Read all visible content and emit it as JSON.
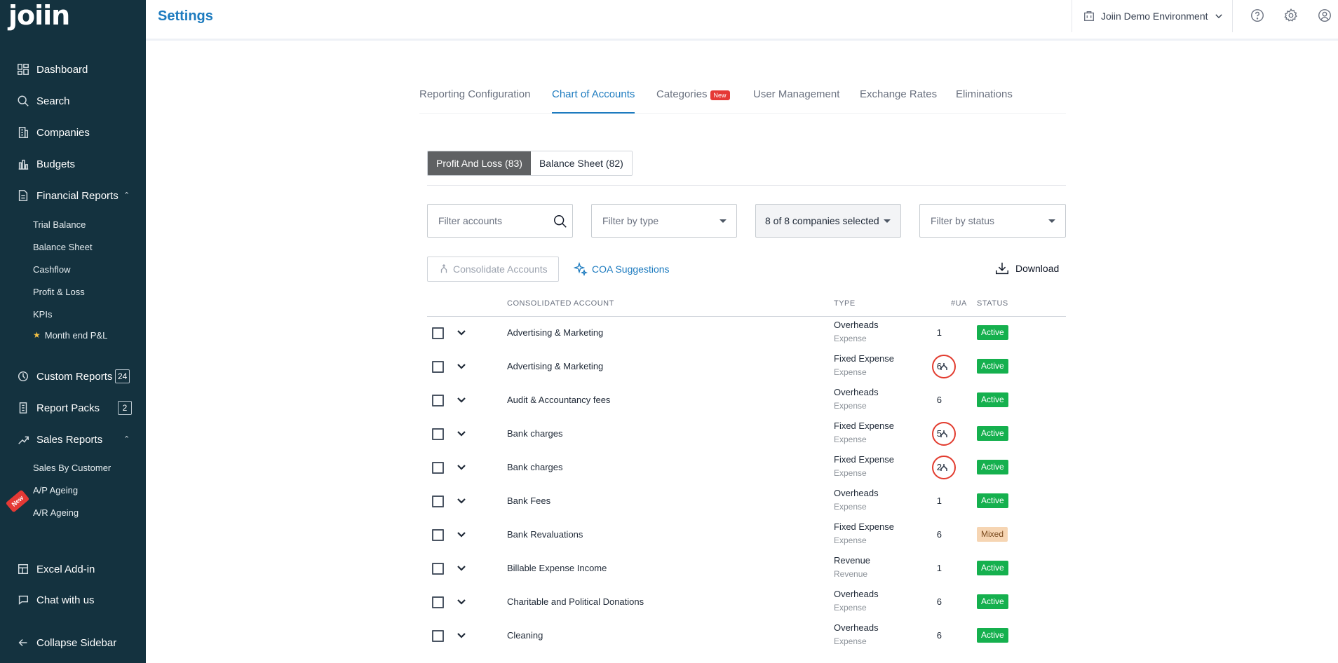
{
  "app": {
    "logo": "joiin"
  },
  "header": {
    "title": "Settings",
    "environment": "Joiin Demo Environment"
  },
  "sidebar": {
    "items": [
      {
        "label": "Dashboard",
        "icon": "dashboard-icon"
      },
      {
        "label": "Search",
        "icon": "search-icon"
      },
      {
        "label": "Companies",
        "icon": "building-icon"
      },
      {
        "label": "Budgets",
        "icon": "bar-chart-icon"
      },
      {
        "label": "Financial Reports",
        "icon": "file-report-icon"
      },
      {
        "label": "Custom Reports",
        "icon": "custom-report-icon",
        "badge": "24"
      },
      {
        "label": "Report Packs",
        "icon": "report-pack-icon",
        "badge": "2"
      },
      {
        "label": "Sales Reports",
        "icon": "sales-icon"
      },
      {
        "label": "Excel Add-in",
        "icon": "excel-icon"
      },
      {
        "label": "Chat with us",
        "icon": "chat-icon"
      },
      {
        "label": "Collapse Sidebar",
        "icon": "arrow-left-icon"
      }
    ],
    "financial_sub": [
      "Trial Balance",
      "Balance Sheet",
      "Cashflow",
      "Profit & Loss",
      "KPIs",
      "Month end P&L"
    ],
    "sales_sub": [
      "Sales By Customer",
      "A/P Ageing",
      "A/R Ageing"
    ],
    "new_ribbon": "New"
  },
  "tabs": [
    {
      "label": "Reporting Configuration"
    },
    {
      "label": "Chart of Accounts"
    },
    {
      "label": "Categories",
      "pill": "New"
    },
    {
      "label": "User Management"
    },
    {
      "label": "Exchange Rates"
    },
    {
      "label": "Eliminations"
    }
  ],
  "segment": {
    "pl": "Profit And Loss (83)",
    "bs": "Balance Sheet (82)"
  },
  "filters": {
    "accounts_placeholder": "Filter accounts",
    "type": "Filter by type",
    "companies": "8 of 8 companies selected",
    "status": "Filter by status"
  },
  "actions": {
    "consolidate": "Consolidate Accounts",
    "coa": "COA Suggestions",
    "download": "Download"
  },
  "table": {
    "headers": {
      "account": "CONSOLIDATED ACCOUNT",
      "type": "TYPE",
      "ua": "#UA",
      "status": "STATUS"
    },
    "rows": [
      {
        "account": "Advertising & Marketing",
        "type": "Overheads",
        "subtype": "Expense",
        "ua": "1",
        "status": "Active",
        "merge": false
      },
      {
        "account": "Advertising & Marketing",
        "type": "Fixed Expense",
        "subtype": "Expense",
        "ua": "6",
        "status": "Active",
        "merge": true
      },
      {
        "account": "Audit & Accountancy fees",
        "type": "Overheads",
        "subtype": "Expense",
        "ua": "6",
        "status": "Active",
        "merge": false
      },
      {
        "account": "Bank charges",
        "type": "Fixed Expense",
        "subtype": "Expense",
        "ua": "5",
        "status": "Active",
        "merge": true
      },
      {
        "account": "Bank charges",
        "type": "Fixed Expense",
        "subtype": "Expense",
        "ua": "2",
        "status": "Active",
        "merge": true
      },
      {
        "account": "Bank Fees",
        "type": "Overheads",
        "subtype": "Expense",
        "ua": "1",
        "status": "Active",
        "merge": false
      },
      {
        "account": "Bank Revaluations",
        "type": "Fixed Expense",
        "subtype": "Expense",
        "ua": "6",
        "status": "Mixed",
        "merge": false
      },
      {
        "account": "Billable Expense Income",
        "type": "Revenue",
        "subtype": "Revenue",
        "ua": "1",
        "status": "Active",
        "merge": false
      },
      {
        "account": "Charitable and Political Donations",
        "type": "Overheads",
        "subtype": "Expense",
        "ua": "6",
        "status": "Active",
        "merge": false
      },
      {
        "account": "Cleaning",
        "type": "Overheads",
        "subtype": "Expense",
        "ua": "6",
        "status": "Active",
        "merge": false
      }
    ]
  },
  "colors": {
    "sidebar": "#14323f",
    "accent": "#1d7bbf",
    "active": "#15b04e",
    "mixed": "#f6d5b3",
    "new": "#e53935"
  }
}
